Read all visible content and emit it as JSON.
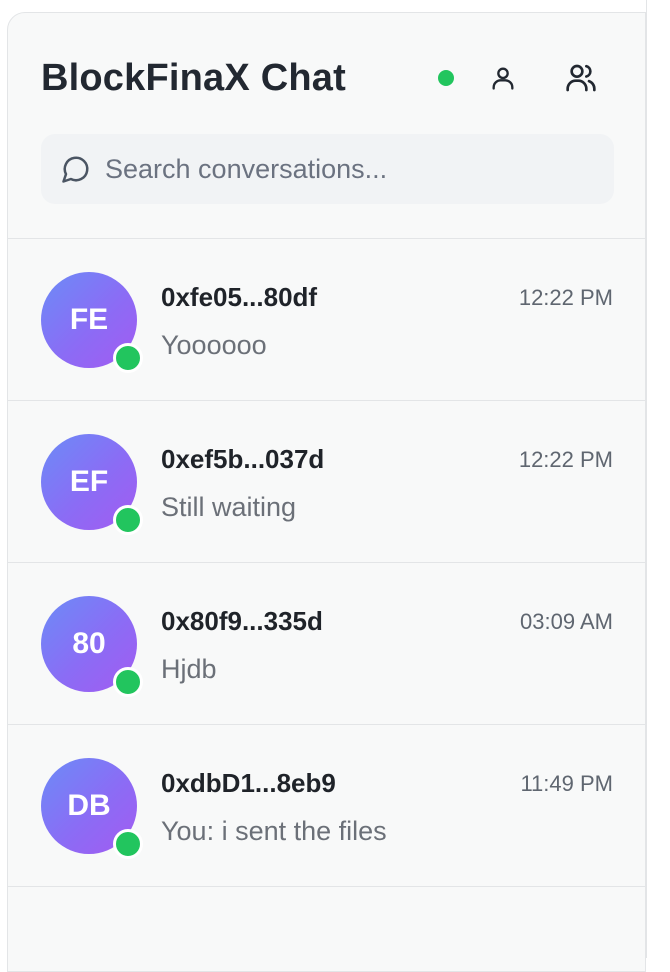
{
  "header": {
    "title": "BlockFinaX Chat",
    "status_color": "#22c55e",
    "icons": [
      "person-icon",
      "users-icon"
    ]
  },
  "search": {
    "placeholder": "Search conversations...",
    "value": ""
  },
  "conversations": [
    {
      "initials": "FE",
      "name": "0xfe05...80df",
      "time": "12:22 PM",
      "preview": "Yoooooo",
      "online": true
    },
    {
      "initials": "EF",
      "name": "0xef5b...037d",
      "time": "12:22 PM",
      "preview": "Still waiting",
      "online": true
    },
    {
      "initials": "80",
      "name": "0x80f9...335d",
      "time": "03:09 AM",
      "preview": "Hjdb",
      "online": true
    },
    {
      "initials": "DB",
      "name": "0xdbD1...8eb9",
      "time": "11:49 PM",
      "preview": "You: i sent the files",
      "online": true
    }
  ]
}
